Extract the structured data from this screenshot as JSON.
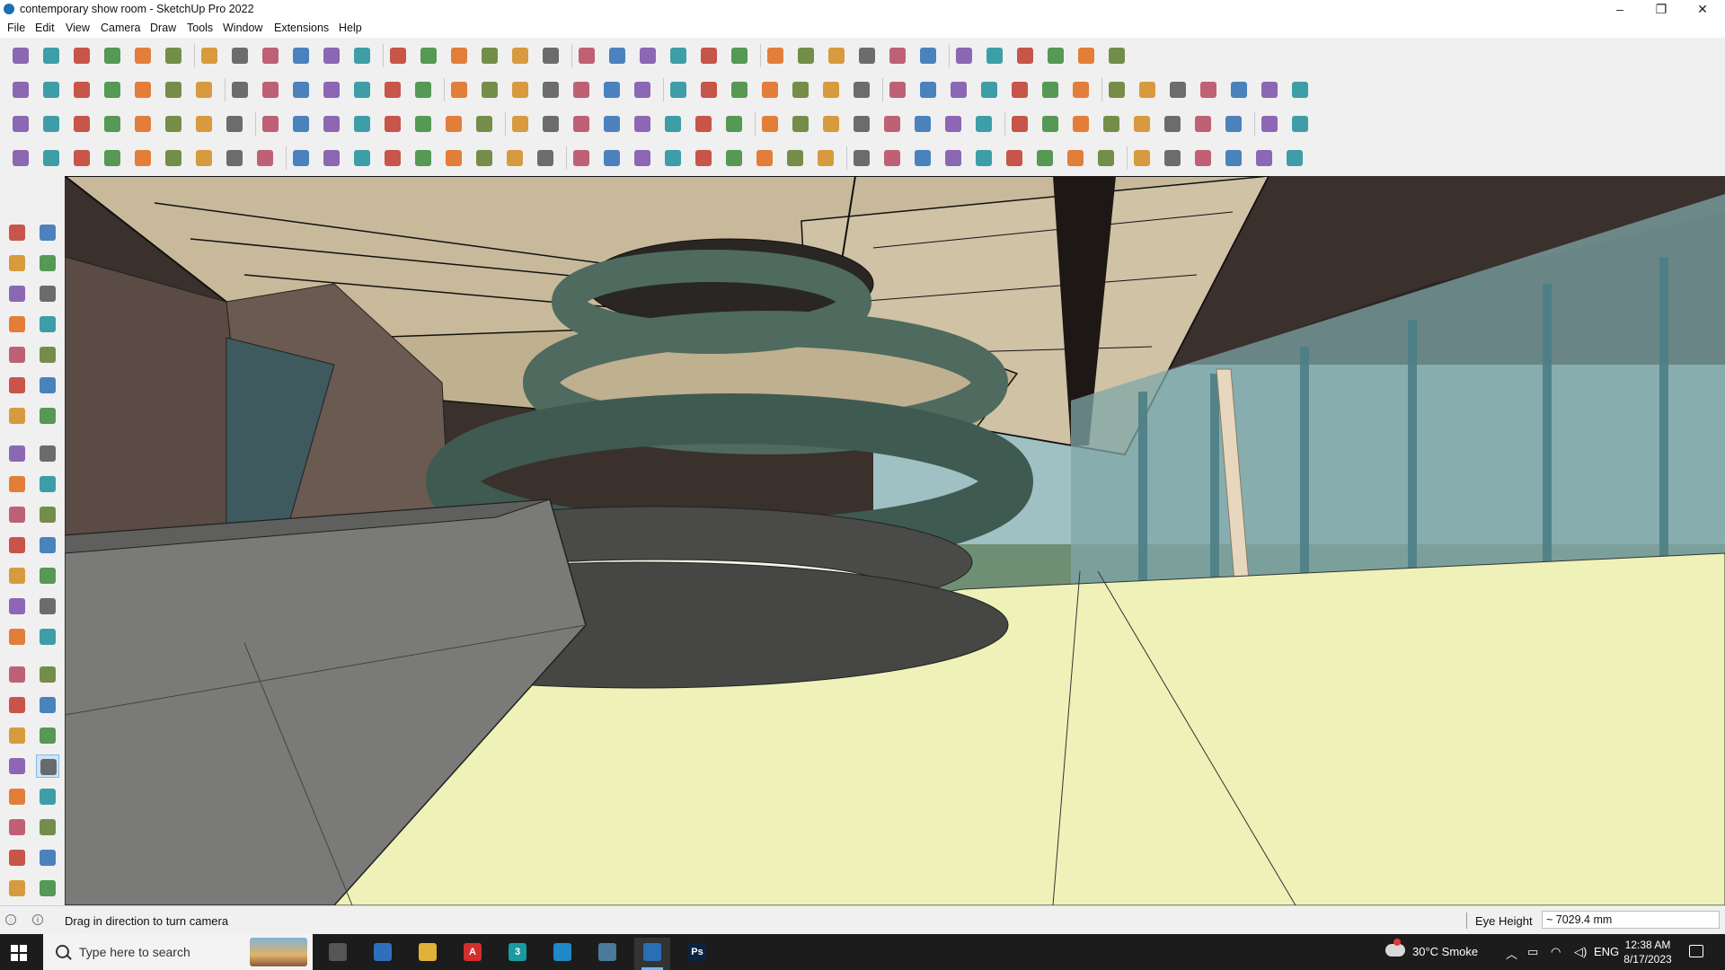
{
  "window": {
    "title": "contemporary show room - SketchUp Pro 2022",
    "minimize_icon": "minimize-icon",
    "restore_icon": "restore-icon",
    "close_icon": "close-icon"
  },
  "menu": [
    "File",
    "Edit",
    "View",
    "Camera",
    "Draw",
    "Tools",
    "Window",
    "Extensions",
    "Help"
  ],
  "statusbar": {
    "hint": "Drag in direction to turn camera",
    "vcb_label": "Eye Height",
    "vcb_value": "~ 7029.4 mm"
  },
  "taskbar": {
    "search_placeholder": "Type here to search",
    "weather": "30°C  Smoke",
    "language": "ENG",
    "time": "12:38 AM",
    "date": "8/17/2023",
    "apps": [
      {
        "name": "task-view",
        "letter": ""
      },
      {
        "name": "calculator",
        "letter": ""
      },
      {
        "name": "file-explorer",
        "letter": ""
      },
      {
        "name": "acrobat",
        "letter": "A"
      },
      {
        "name": "3ds-max",
        "letter": "3"
      },
      {
        "name": "edge",
        "letter": ""
      },
      {
        "name": "snipping-tool",
        "letter": ""
      },
      {
        "name": "sketchup",
        "letter": ""
      },
      {
        "name": "photoshop",
        "letter": "Ps"
      }
    ]
  },
  "tray_icons": [
    "chevron-up-icon",
    "display-icon",
    "wifi-icon",
    "volume-icon"
  ],
  "status_icons": [
    "geo-location-icon",
    "credits-icon"
  ],
  "colors": {
    "ceiling": "#c8b99a",
    "floor": "#eef2b8",
    "stair": "#4f6a5e",
    "glass": "#8bb3b8",
    "walls": "#4a3f3a"
  },
  "active_tool": "look-around-tool"
}
